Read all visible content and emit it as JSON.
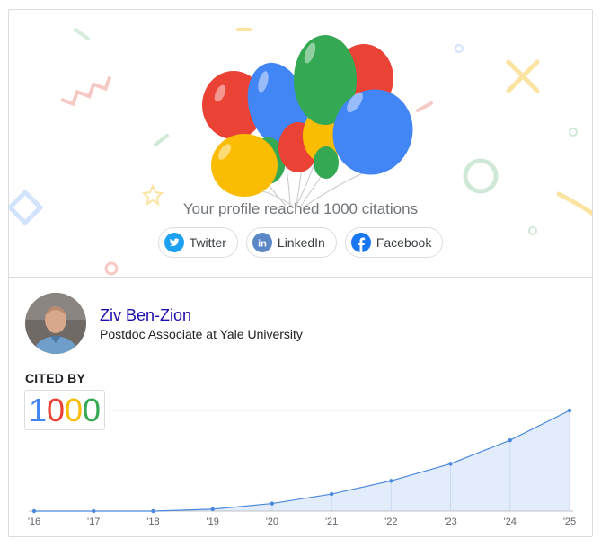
{
  "milestone": {
    "message": "Your profile reached 1000 citations",
    "share": [
      {
        "label": "Twitter",
        "icon": "twitter-icon",
        "color": "#1da1f2"
      },
      {
        "label": "LinkedIn",
        "icon": "linkedin-icon",
        "color": "#0a66c2"
      },
      {
        "label": "Facebook",
        "icon": "facebook-icon",
        "color": "#1877f2"
      }
    ],
    "balloon_colors": [
      "#ea4335",
      "#4285f4",
      "#34a853",
      "#fbbc04"
    ]
  },
  "profile": {
    "name": "Ziv Ben-Zion",
    "affiliation": "Postdoc Associate at Yale University"
  },
  "citations": {
    "label": "CITED BY",
    "count_digits": [
      {
        "d": "1",
        "color": "#4285f4"
      },
      {
        "d": "0",
        "color": "#ea4335"
      },
      {
        "d": "0",
        "color": "#fbbc04"
      },
      {
        "d": "0",
        "color": "#34a853"
      }
    ]
  },
  "chart_data": {
    "type": "area",
    "categories": [
      "'16",
      "'17",
      "'18",
      "'19",
      "'20",
      "'21",
      "'22",
      "'23",
      "'24",
      "'25"
    ],
    "values": [
      0,
      0,
      0,
      10,
      40,
      90,
      160,
      250,
      375,
      532
    ],
    "ylim": [
      0,
      532
    ],
    "line_color": "#4a89dc",
    "fill_color": "#e3ecfb",
    "grid": true
  }
}
